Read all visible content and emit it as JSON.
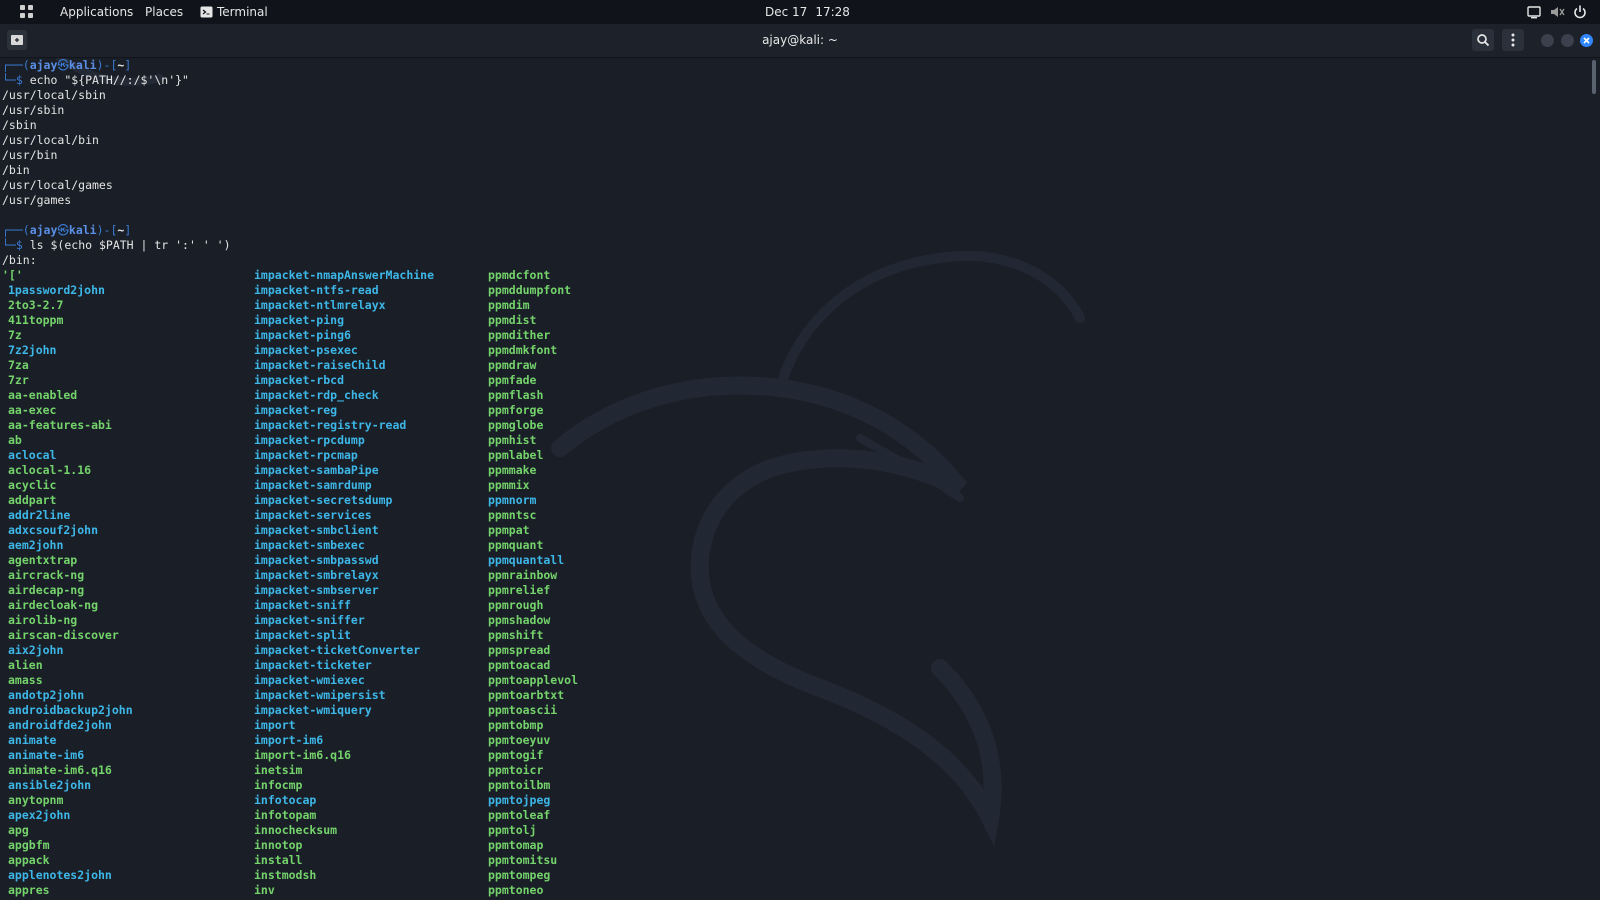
{
  "top_panel": {
    "applications_label": "Applications",
    "places_label": "Places",
    "terminal_label": "Terminal",
    "date": "Dec 17",
    "time": "17:28"
  },
  "window": {
    "title": "ajay@kali: ~"
  },
  "prompt": {
    "user": "ajay",
    "host": "kali",
    "dir": "~",
    "symbol": "$"
  },
  "session": {
    "cmd1": "echo \"${PATH//:/$'\\n'}\"",
    "path_output": [
      "/usr/local/sbin",
      "/usr/sbin",
      "/sbin",
      "/usr/local/bin",
      "/usr/bin",
      "/bin",
      "/usr/local/games",
      "/usr/games"
    ],
    "cmd2": "ls $(echo $PATH | tr ':' ' ')",
    "dir_header": "/bin:",
    "first_entry": "'['"
  },
  "listing": {
    "col1": [
      {
        "name": "1password2john",
        "t": "lnk"
      },
      {
        "name": "2to3-2.7",
        "t": "exe"
      },
      {
        "name": "411toppm",
        "t": "exe"
      },
      {
        "name": "7z",
        "t": "exe"
      },
      {
        "name": "7z2john",
        "t": "lnk"
      },
      {
        "name": "7za",
        "t": "exe"
      },
      {
        "name": "7zr",
        "t": "exe"
      },
      {
        "name": "aa-enabled",
        "t": "exe"
      },
      {
        "name": "aa-exec",
        "t": "exe"
      },
      {
        "name": "aa-features-abi",
        "t": "exe"
      },
      {
        "name": "ab",
        "t": "exe"
      },
      {
        "name": "aclocal",
        "t": "lnk"
      },
      {
        "name": "aclocal-1.16",
        "t": "exe"
      },
      {
        "name": "acyclic",
        "t": "exe"
      },
      {
        "name": "addpart",
        "t": "exe"
      },
      {
        "name": "addr2line",
        "t": "lnk"
      },
      {
        "name": "adxcsouf2john",
        "t": "lnk"
      },
      {
        "name": "aem2john",
        "t": "lnk"
      },
      {
        "name": "agentxtrap",
        "t": "exe"
      },
      {
        "name": "aircrack-ng",
        "t": "exe"
      },
      {
        "name": "airdecap-ng",
        "t": "exe"
      },
      {
        "name": "airdecloak-ng",
        "t": "exe"
      },
      {
        "name": "airolib-ng",
        "t": "exe"
      },
      {
        "name": "airscan-discover",
        "t": "exe"
      },
      {
        "name": "aix2john",
        "t": "lnk"
      },
      {
        "name": "alien",
        "t": "exe"
      },
      {
        "name": "amass",
        "t": "exe"
      },
      {
        "name": "andotp2john",
        "t": "lnk"
      },
      {
        "name": "androidbackup2john",
        "t": "lnk"
      },
      {
        "name": "androidfde2john",
        "t": "lnk"
      },
      {
        "name": "animate",
        "t": "lnk"
      },
      {
        "name": "animate-im6",
        "t": "lnk"
      },
      {
        "name": "animate-im6.q16",
        "t": "exe"
      },
      {
        "name": "ansible2john",
        "t": "lnk"
      },
      {
        "name": "anytopnm",
        "t": "exe"
      },
      {
        "name": "apex2john",
        "t": "lnk"
      },
      {
        "name": "apg",
        "t": "exe"
      },
      {
        "name": "apgbfm",
        "t": "exe"
      },
      {
        "name": "appack",
        "t": "exe"
      },
      {
        "name": "applenotes2john",
        "t": "lnk"
      },
      {
        "name": "appres",
        "t": "exe"
      }
    ],
    "col2": [
      {
        "name": "impacket-nmapAnswerMachine",
        "t": "lnk"
      },
      {
        "name": "impacket-ntfs-read",
        "t": "lnk"
      },
      {
        "name": "impacket-ntlmrelayx",
        "t": "lnk"
      },
      {
        "name": "impacket-ping",
        "t": "lnk"
      },
      {
        "name": "impacket-ping6",
        "t": "lnk"
      },
      {
        "name": "impacket-psexec",
        "t": "lnk"
      },
      {
        "name": "impacket-raiseChild",
        "t": "lnk"
      },
      {
        "name": "impacket-rbcd",
        "t": "lnk"
      },
      {
        "name": "impacket-rdp_check",
        "t": "lnk"
      },
      {
        "name": "impacket-reg",
        "t": "lnk"
      },
      {
        "name": "impacket-registry-read",
        "t": "lnk"
      },
      {
        "name": "impacket-rpcdump",
        "t": "lnk"
      },
      {
        "name": "impacket-rpcmap",
        "t": "lnk"
      },
      {
        "name": "impacket-sambaPipe",
        "t": "lnk"
      },
      {
        "name": "impacket-samrdump",
        "t": "lnk"
      },
      {
        "name": "impacket-secretsdump",
        "t": "lnk"
      },
      {
        "name": "impacket-services",
        "t": "lnk"
      },
      {
        "name": "impacket-smbclient",
        "t": "lnk"
      },
      {
        "name": "impacket-smbexec",
        "t": "lnk"
      },
      {
        "name": "impacket-smbpasswd",
        "t": "lnk"
      },
      {
        "name": "impacket-smbrelayx",
        "t": "lnk"
      },
      {
        "name": "impacket-smbserver",
        "t": "lnk"
      },
      {
        "name": "impacket-sniff",
        "t": "lnk"
      },
      {
        "name": "impacket-sniffer",
        "t": "lnk"
      },
      {
        "name": "impacket-split",
        "t": "lnk"
      },
      {
        "name": "impacket-ticketConverter",
        "t": "lnk"
      },
      {
        "name": "impacket-ticketer",
        "t": "lnk"
      },
      {
        "name": "impacket-wmiexec",
        "t": "lnk"
      },
      {
        "name": "impacket-wmipersist",
        "t": "lnk"
      },
      {
        "name": "impacket-wmiquery",
        "t": "lnk"
      },
      {
        "name": "import",
        "t": "lnk"
      },
      {
        "name": "import-im6",
        "t": "lnk"
      },
      {
        "name": "import-im6.q16",
        "t": "exe"
      },
      {
        "name": "inetsim",
        "t": "exe"
      },
      {
        "name": "infocmp",
        "t": "exe"
      },
      {
        "name": "infotocap",
        "t": "lnk"
      },
      {
        "name": "infotopam",
        "t": "exe"
      },
      {
        "name": "innochecksum",
        "t": "exe"
      },
      {
        "name": "innotop",
        "t": "exe"
      },
      {
        "name": "install",
        "t": "exe"
      },
      {
        "name": "instmodsh",
        "t": "exe"
      },
      {
        "name": "inv",
        "t": "exe"
      }
    ],
    "col3": [
      {
        "name": "ppmdcfont",
        "t": "exe"
      },
      {
        "name": "ppmddumpfont",
        "t": "exe"
      },
      {
        "name": "ppmdim",
        "t": "exe"
      },
      {
        "name": "ppmdist",
        "t": "exe"
      },
      {
        "name": "ppmdither",
        "t": "exe"
      },
      {
        "name": "ppmdmkfont",
        "t": "exe"
      },
      {
        "name": "ppmdraw",
        "t": "exe"
      },
      {
        "name": "ppmfade",
        "t": "exe"
      },
      {
        "name": "ppmflash",
        "t": "exe"
      },
      {
        "name": "ppmforge",
        "t": "exe"
      },
      {
        "name": "ppmglobe",
        "t": "exe"
      },
      {
        "name": "ppmhist",
        "t": "exe"
      },
      {
        "name": "ppmlabel",
        "t": "exe"
      },
      {
        "name": "ppmmake",
        "t": "exe"
      },
      {
        "name": "ppmmix",
        "t": "exe"
      },
      {
        "name": "ppmnorm",
        "t": "lnk"
      },
      {
        "name": "ppmntsc",
        "t": "exe"
      },
      {
        "name": "ppmpat",
        "t": "exe"
      },
      {
        "name": "ppmquant",
        "t": "exe"
      },
      {
        "name": "ppmquantall",
        "t": "lnk"
      },
      {
        "name": "ppmrainbow",
        "t": "exe"
      },
      {
        "name": "ppmrelief",
        "t": "exe"
      },
      {
        "name": "ppmrough",
        "t": "exe"
      },
      {
        "name": "ppmshadow",
        "t": "exe"
      },
      {
        "name": "ppmshift",
        "t": "exe"
      },
      {
        "name": "ppmspread",
        "t": "exe"
      },
      {
        "name": "ppmtoacad",
        "t": "exe"
      },
      {
        "name": "ppmtoapplevol",
        "t": "exe"
      },
      {
        "name": "ppmtoarbtxt",
        "t": "exe"
      },
      {
        "name": "ppmtoascii",
        "t": "exe"
      },
      {
        "name": "ppmtobmp",
        "t": "exe"
      },
      {
        "name": "ppmtoeyuv",
        "t": "exe"
      },
      {
        "name": "ppmtogif",
        "t": "exe"
      },
      {
        "name": "ppmtoicr",
        "t": "exe"
      },
      {
        "name": "ppmtoilbm",
        "t": "exe"
      },
      {
        "name": "ppmtojpeg",
        "t": "lnk"
      },
      {
        "name": "ppmtoleaf",
        "t": "exe"
      },
      {
        "name": "ppmtolj",
        "t": "exe"
      },
      {
        "name": "ppmtomap",
        "t": "exe"
      },
      {
        "name": "ppmtomitsu",
        "t": "exe"
      },
      {
        "name": "ppmtompeg",
        "t": "exe"
      },
      {
        "name": "ppmtoneo",
        "t": "exe"
      }
    ]
  },
  "colors": {
    "exec": "#74d36b",
    "symlink": "#3db7e8",
    "prompt": "#3a7bd5"
  },
  "icons": [
    "app-grid-icon",
    "terminal-icon",
    "screen-icon",
    "mute-icon",
    "power-icon",
    "new-tab-icon",
    "search-icon",
    "menu-dots-icon",
    "minimize-icon",
    "maximize-icon",
    "close-icon"
  ]
}
